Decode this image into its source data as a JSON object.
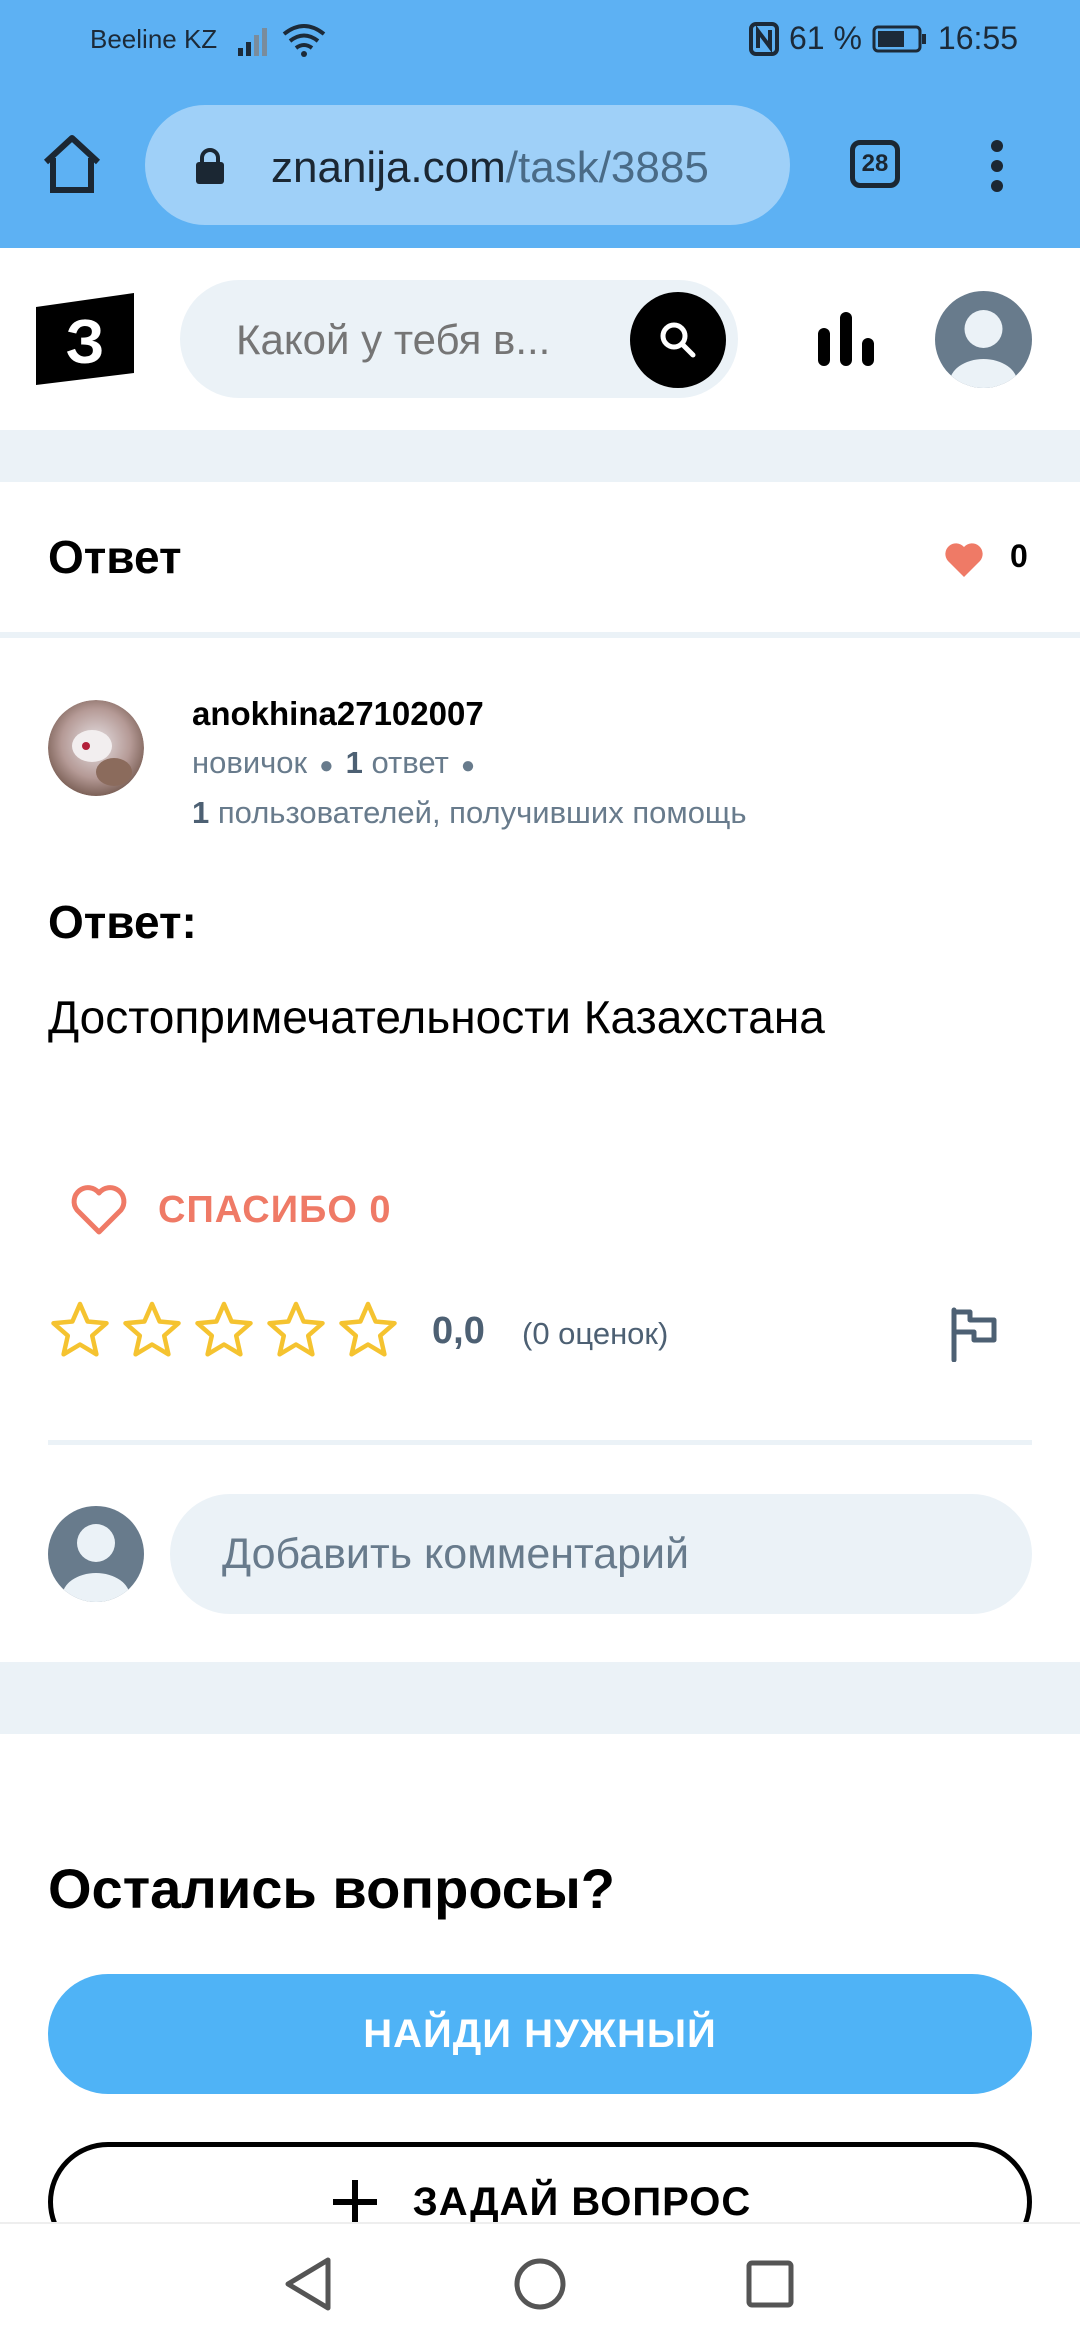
{
  "status_bar": {
    "carrier": "Beeline KZ",
    "battery": "61 %",
    "time": "16:55",
    "icons": [
      "signal-icon",
      "wifi-icon",
      "nfc-icon",
      "battery-icon"
    ]
  },
  "browser": {
    "url_host": "znanija.com",
    "url_path": "/task/3885",
    "tab_count": "28",
    "icons": [
      "home-icon",
      "lock-icon",
      "tabs-icon",
      "more-vert-icon"
    ]
  },
  "header": {
    "logo_text": "З",
    "search_placeholder": "Какой у тебя в...",
    "icons": [
      "search-icon",
      "stats-icon",
      "profile-avatar-icon"
    ]
  },
  "answer_header": {
    "title": "Ответ",
    "favorites_count": "0"
  },
  "author": {
    "name": "anokhina27102007",
    "rank": "новичок",
    "answers_count": "1",
    "answers_label": "ответ",
    "helped_count": "1",
    "helped_label": "пользователей, получивших помощь"
  },
  "answer": {
    "label": "Ответ:",
    "text": "Достопримечательности Казахстана"
  },
  "thanks": {
    "label": "СПАСИБО 0"
  },
  "rating": {
    "stars_filled": 0,
    "stars_total": 5,
    "value": "0,0",
    "count_text": "(0 оценок)"
  },
  "comment": {
    "placeholder": "Добавить комментарий"
  },
  "questions": {
    "title": "Остались вопросы?",
    "find_button": "НАЙДИ НУЖНЫЙ",
    "ask_button": "ЗАДАЙ ВОПРОС"
  },
  "colors": {
    "browser_blue": "#5db1f3",
    "button_blue": "#4fb3f6",
    "thanks_red": "#ef7a66",
    "star_yellow": "#f5c330",
    "grey_band": "#ebf2f7"
  }
}
